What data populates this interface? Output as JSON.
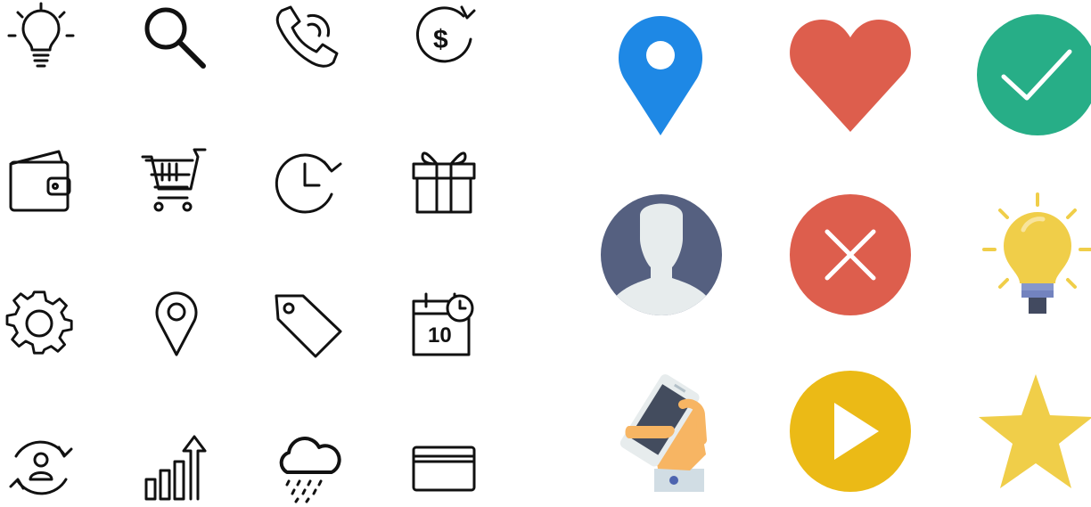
{
  "line_icons": [
    {
      "name": "lightbulb-icon"
    },
    {
      "name": "search-icon"
    },
    {
      "name": "phone-call-icon"
    },
    {
      "name": "dollar-refresh-icon"
    },
    {
      "name": "wallet-icon"
    },
    {
      "name": "shopping-cart-icon"
    },
    {
      "name": "clock-history-icon"
    },
    {
      "name": "gift-icon"
    },
    {
      "name": "gear-icon"
    },
    {
      "name": "map-pin-icon"
    },
    {
      "name": "price-tag-icon"
    },
    {
      "name": "calendar-clock-icon",
      "day_label": "10"
    },
    {
      "name": "user-sync-icon"
    },
    {
      "name": "growth-chart-icon"
    },
    {
      "name": "rain-cloud-icon"
    },
    {
      "name": "credit-card-icon"
    }
  ],
  "flat_icons": [
    {
      "name": "location-pin-icon",
      "color": "#1E88E5"
    },
    {
      "name": "heart-icon",
      "color": "#DD5E4D"
    },
    {
      "name": "check-circle-icon",
      "color": "#27AE87"
    },
    {
      "name": "user-avatar-icon",
      "color": "#556080"
    },
    {
      "name": "close-circle-icon",
      "color": "#DD5E4D"
    },
    {
      "name": "lightbulb-flat-icon",
      "color": "#F0CE49"
    },
    {
      "name": "hand-phone-icon",
      "color": "#434C5E"
    },
    {
      "name": "play-circle-icon",
      "color": "#EBBA16"
    },
    {
      "name": "star-icon",
      "color": "#F0CE49"
    }
  ]
}
